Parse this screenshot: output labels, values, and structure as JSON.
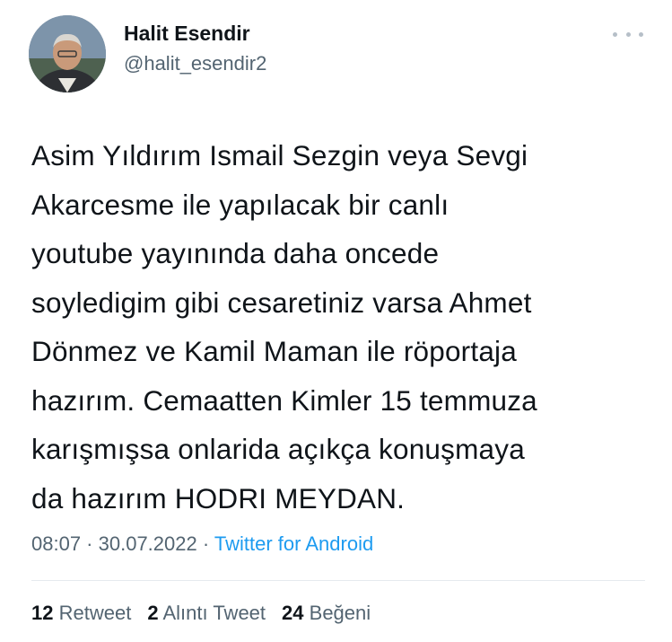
{
  "author": {
    "display_name": "Halit Esendir",
    "handle": "@halit_esendir2",
    "avatar_icon": "profile-photo"
  },
  "menu_icon": "more-horizontal-icon",
  "tweet": {
    "text": "Asim Yıldırım Ismail Sezgin veya Sevgi\nAkarcesme ile yapılacak bir canlı\nyoutube yayınında daha oncede\nsoyledigim gibi cesaretiniz varsa Ahmet\nDönmez ve Kamil Maman ile röportaja\nhazırım. Cemaatten Kimler 15 temmuza\nkarışmışsa onlarida açıkça  konuşmaya\nda hazırım  HODRI MEYDAN."
  },
  "meta": {
    "time": "08:07",
    "sep1": " · ",
    "date": "30.07.2022",
    "sep2": " · ",
    "source": "Twitter for Android"
  },
  "stats": {
    "retweets_count": "12",
    "retweets_label": "Retweet",
    "quotes_count": "2",
    "quotes_label": "Alıntı Tweet",
    "likes_count": "24",
    "likes_label": "Beğeni"
  },
  "colors": {
    "text": "#0f1419",
    "secondary": "#536471",
    "link": "#1d9bf0",
    "divider": "#e6eaee"
  }
}
